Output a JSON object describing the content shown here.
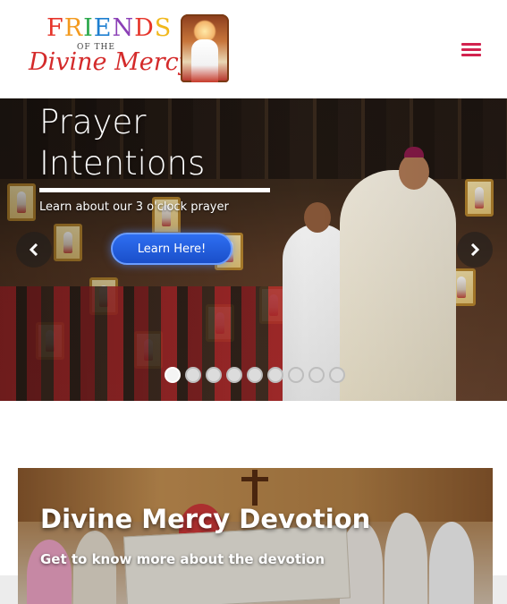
{
  "header": {
    "logo": {
      "line1_letters": [
        {
          "char": "F",
          "color": "#e6352b"
        },
        {
          "char": "R",
          "color": "#f39a1e"
        },
        {
          "char": "I",
          "color": "#2aa84a"
        },
        {
          "char": "E",
          "color": "#1e7fd0"
        },
        {
          "char": "N",
          "color": "#8b3fb6"
        },
        {
          "char": "D",
          "color": "#e6352b"
        },
        {
          "char": "S",
          "color": "#f1b81c"
        }
      ],
      "line2": "OF THE",
      "line3": "Divine Mercy",
      "image_icon": "divine-mercy-image"
    },
    "menu_icon": "hamburger-menu-icon",
    "menu_color": "#d2234f"
  },
  "hero": {
    "title_line1": "Prayer",
    "title_line2": "Intentions",
    "subtitle": "Learn about our 3 o'clock prayer",
    "button_label": "Learn Here!",
    "prev_icon": "chevron-left-icon",
    "next_icon": "chevron-right-icon",
    "slide_count": 9,
    "active_slide": 0
  },
  "card": {
    "title": "Divine Mercy Devotion",
    "subtitle": "Get to know more about the devotion"
  }
}
